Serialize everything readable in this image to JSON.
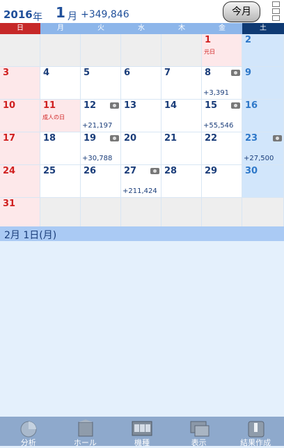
{
  "header": {
    "year": "2016",
    "year_suffix": "年",
    "month": "1",
    "month_suffix": "月",
    "total": "+349,846",
    "today_label": "今月"
  },
  "weekdays": [
    "日",
    "月",
    "火",
    "水",
    "木",
    "金",
    "土"
  ],
  "calendar": {
    "weeks": [
      [
        {
          "d": ""
        },
        {
          "d": ""
        },
        {
          "d": ""
        },
        {
          "d": ""
        },
        {
          "d": ""
        },
        {
          "d": "1",
          "holiday": "元日"
        },
        {
          "d": "2"
        }
      ],
      [
        {
          "d": "3"
        },
        {
          "d": "4"
        },
        {
          "d": "5"
        },
        {
          "d": "6"
        },
        {
          "d": "7"
        },
        {
          "d": "8",
          "amt": "+3,391",
          "cam": true
        },
        {
          "d": "9"
        }
      ],
      [
        {
          "d": "10"
        },
        {
          "d": "11",
          "holiday": "成人の日"
        },
        {
          "d": "12",
          "amt": "+21,197",
          "cam": true
        },
        {
          "d": "13"
        },
        {
          "d": "14"
        },
        {
          "d": "15",
          "amt": "+55,546",
          "cam": true
        },
        {
          "d": "16"
        }
      ],
      [
        {
          "d": "17"
        },
        {
          "d": "18"
        },
        {
          "d": "19",
          "amt": "+30,788",
          "cam": true
        },
        {
          "d": "20"
        },
        {
          "d": "21"
        },
        {
          "d": "22"
        },
        {
          "d": "23",
          "amt": "+27,500",
          "cam": true
        }
      ],
      [
        {
          "d": "24"
        },
        {
          "d": "25"
        },
        {
          "d": "26"
        },
        {
          "d": "27",
          "amt": "+211,424",
          "cam": true
        },
        {
          "d": "28"
        },
        {
          "d": "29"
        },
        {
          "d": "30"
        }
      ],
      [
        {
          "d": "31"
        },
        {
          "d": ""
        },
        {
          "d": ""
        },
        {
          "d": ""
        },
        {
          "d": ""
        },
        {
          "d": ""
        },
        {
          "d": ""
        }
      ]
    ]
  },
  "selected_date": "2月 1日(月)",
  "tabs": [
    {
      "label": "分析",
      "icon": "pie-chart-icon"
    },
    {
      "label": "ホール",
      "icon": "building-icon"
    },
    {
      "label": "機種",
      "icon": "slot-machine-icon"
    },
    {
      "label": "表示",
      "icon": "display-icon"
    },
    {
      "label": "結果作成",
      "icon": "edit-icon"
    }
  ]
}
